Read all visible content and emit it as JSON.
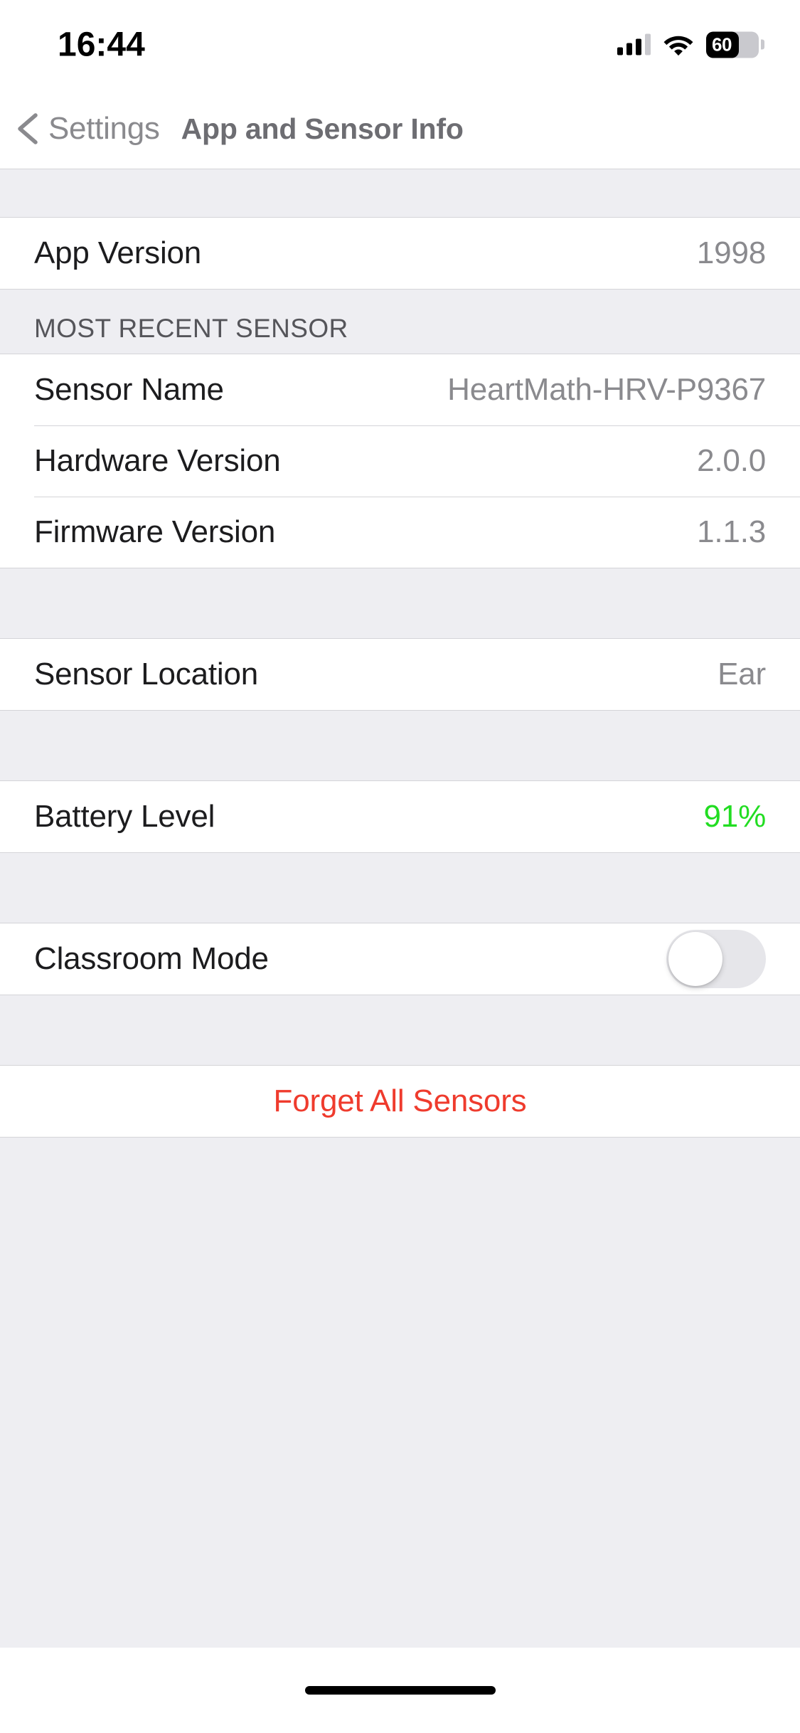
{
  "status_bar": {
    "time": "16:44",
    "battery_percent": "60",
    "battery_fill_ratio": 0.62,
    "icons": {
      "cellular": "cellular-signal-icon",
      "wifi": "wifi-icon",
      "battery": "battery-icon"
    }
  },
  "nav": {
    "back_label": "Settings",
    "title": "App and Sensor Info"
  },
  "sections": {
    "app": {
      "rows": [
        {
          "label": "App Version",
          "value": "1998"
        }
      ]
    },
    "most_recent_sensor": {
      "header": "MOST RECENT SENSOR",
      "rows": [
        {
          "label": "Sensor Name",
          "value": "HeartMath-HRV-P9367"
        },
        {
          "label": "Hardware Version",
          "value": "2.0.0"
        },
        {
          "label": "Firmware Version",
          "value": "1.1.3"
        }
      ]
    },
    "location": {
      "rows": [
        {
          "label": "Sensor Location",
          "value": "Ear"
        }
      ]
    },
    "battery": {
      "rows": [
        {
          "label": "Battery Level",
          "value": "91%"
        }
      ]
    },
    "classroom": {
      "rows": [
        {
          "label": "Classroom Mode",
          "value": "off"
        }
      ]
    },
    "destructive": {
      "label": "Forget All Sensors"
    }
  },
  "colors": {
    "background": "#eeeef2",
    "row_background": "#ffffff",
    "separator": "#d4d4d8",
    "primary_text": "#1c1c1e",
    "secondary_text": "#8a8a8e",
    "battery_green": "#22dd22",
    "destructive_red": "#ef3b2d",
    "nav_title": "#6d6d72"
  }
}
